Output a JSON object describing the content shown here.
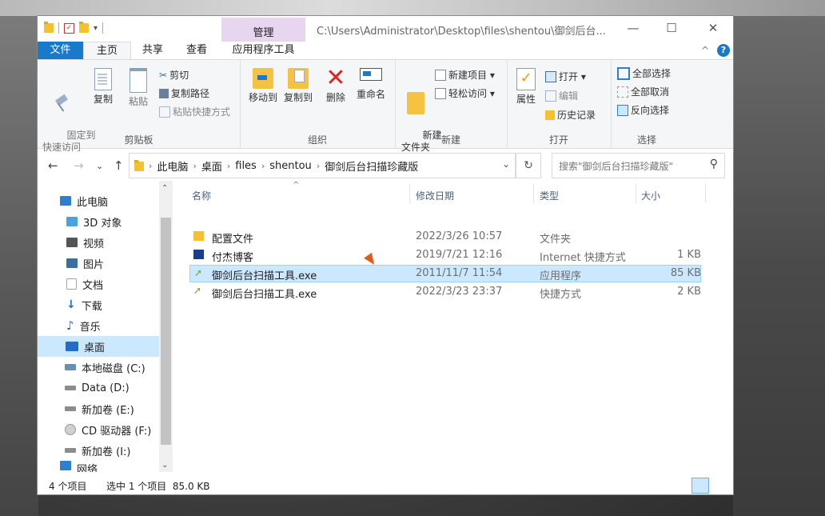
{
  "window": {
    "title": "C:\\Users\\Administrator\\Desktop\\files\\shentou\\御剑后台...",
    "context_tab": "管理",
    "controls": {
      "minimize": "—",
      "maximize": "☐",
      "close": "✕"
    }
  },
  "ribbon_tabs": [
    "文件",
    "主页",
    "共享",
    "查看",
    "应用程序工具"
  ],
  "ribbon": {
    "clipboard": {
      "label": "剪贴板",
      "pin": "固定到\n快速访问",
      "copy": "复制",
      "paste": "粘贴",
      "cut": "剪切",
      "copy_path": "复制路径",
      "paste_shortcut": "粘贴快捷方式"
    },
    "organize": {
      "label": "组织",
      "move_to": "移动到",
      "copy_to": "复制到",
      "delete": "删除",
      "rename": "重命名"
    },
    "new": {
      "label": "新建",
      "new_folder": "新建\n文件夹",
      "new_item": "新建项目 ▾",
      "easy_access": "轻松访问 ▾"
    },
    "open": {
      "label": "打开",
      "properties": "属性",
      "open": "打开 ▾",
      "edit": "编辑",
      "history": "历史记录"
    },
    "select": {
      "label": "选择",
      "select_all": "全部选择",
      "select_none": "全部取消",
      "invert": "反向选择"
    }
  },
  "address": {
    "crumbs": [
      "此电脑",
      "桌面",
      "files",
      "shentou",
      "御剑后台扫描珍藏版"
    ],
    "search_placeholder": "搜索\"御剑后台扫描珍藏版\""
  },
  "nav_pane": [
    {
      "label": "此电脑",
      "icon": "computer-icon",
      "color": "#2f7fd0"
    },
    {
      "label": "3D 对象",
      "icon": "cube-icon",
      "color": "#4aa3df"
    },
    {
      "label": "视频",
      "icon": "film-icon",
      "color": "#555555"
    },
    {
      "label": "图片",
      "icon": "picture-icon",
      "color": "#3a6ea5"
    },
    {
      "label": "文档",
      "icon": "document-icon",
      "color": "#9aa7b5"
    },
    {
      "label": "下载",
      "icon": "download-icon",
      "color": "#1f6fc8"
    },
    {
      "label": "音乐",
      "icon": "music-icon",
      "color": "#1f6fc8"
    },
    {
      "label": "桌面",
      "icon": "desktop-icon",
      "color": "#1f6fc8"
    },
    {
      "label": "本地磁盘 (C:)",
      "icon": "disk-icon",
      "color": "#6a8fb5"
    },
    {
      "label": "Data (D:)",
      "icon": "drive-icon",
      "color": "#8c8c8c"
    },
    {
      "label": "新加卷 (E:)",
      "icon": "drive-icon",
      "color": "#8c8c8c"
    },
    {
      "label": "CD 驱动器 (F:)",
      "icon": "cd-icon",
      "color": "#9a9a9a"
    },
    {
      "label": "新加卷 (I:)",
      "icon": "drive-icon",
      "color": "#8c8c8c"
    },
    {
      "label": "网络",
      "icon": "network-icon",
      "color": "#2f7fd0"
    }
  ],
  "file_list": {
    "columns": [
      "名称",
      "修改日期",
      "类型",
      "大小"
    ],
    "rows": [
      {
        "name": "配置文件",
        "date": "2022/3/26 10:57",
        "type": "文件夹",
        "size": "",
        "icon": "folder-icon",
        "color": "#f2c230"
      },
      {
        "name": "付杰博客",
        "date": "2019/7/21 12:16",
        "type": "Internet 快捷方式",
        "size": "1 KB",
        "icon": "url-shortcut-icon",
        "color": "#1c3d8c"
      },
      {
        "name": "御剑后台扫描工具.exe",
        "date": "2011/11/7 11:54",
        "type": "应用程序",
        "size": "85 KB",
        "icon": "sword-app-icon",
        "color": "#6aa64a"
      },
      {
        "name": "御剑后台扫描工具.exe",
        "date": "2022/3/23 23:37",
        "type": "快捷方式",
        "size": "2 KB",
        "icon": "shortcut-icon",
        "color": "#6aa64a"
      }
    ]
  },
  "status": {
    "count": "4 个项目",
    "selected": "选中 1 个项目  85.0 KB"
  }
}
